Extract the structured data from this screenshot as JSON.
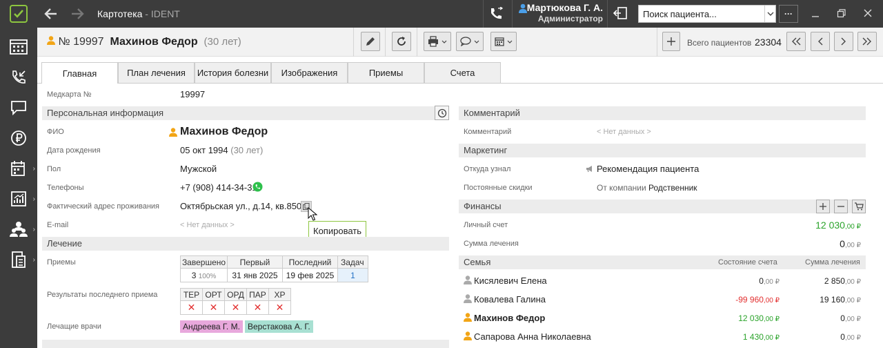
{
  "topbar": {
    "app_title": "Картотека",
    "app_suffix": " - IDENT",
    "user_name": "Мартюкова Г. А.",
    "user_role": "Администратор",
    "search_placeholder": "Поиск пациента...",
    "more_label": "···"
  },
  "header": {
    "card_number": "№ 19997",
    "patient_name": "Махинов Федор",
    "patient_age": "(30 лет)",
    "total_label": "Всего пациентов",
    "total_value": "23304"
  },
  "tabs": [
    "Главная",
    "План лечения",
    "История болезни",
    "Изображения",
    "Приемы",
    "Счета"
  ],
  "left": {
    "medcard_label": "Медкарта №",
    "medcard_value": "19997",
    "personal_section": "Персональная информация",
    "fio_label": "ФИО",
    "fio_value": "Махинов Федор",
    "dob_label": "Дата рождения",
    "dob_value": "05 окт 1994",
    "dob_age": "(30 лет)",
    "sex_label": "Пол",
    "sex_value": "Мужской",
    "phone_label": "Телефоны",
    "phone_value": "+7 (908) 414-34-31",
    "address_label": "Фактический адрес проживания",
    "address_value": "Октябрьская ул., д.14, кв.850",
    "copy_tooltip": "Копировать",
    "email_label": "E-mail",
    "email_value": "< Нет данных >",
    "treatment_section": "Лечение",
    "visits_label": "Приемы",
    "visits_headers": [
      "Завершено",
      "Первый",
      "Последний",
      "Задач"
    ],
    "visits_completed": "3",
    "visits_percent": "100%",
    "visits_first": "31 янв 2025",
    "visits_last": "19 фев 2025",
    "visits_tasks": "1",
    "results_label": "Результаты последнего приема",
    "results_headers": [
      "ТЕР",
      "ОРТ",
      "ОРД",
      "ПАР",
      "ХР"
    ],
    "results_mark": "✕",
    "doctors_label": "Лечащие врачи",
    "doctors": [
      "Андреева Г. М.",
      "Верстакова А. Г."
    ]
  },
  "right": {
    "comment_section": "Комментарий",
    "comment_label": "Комментарий",
    "comment_value": "< Нет данных >",
    "marketing_section": "Маркетинг",
    "source_label": "Откуда узнал",
    "source_value": "Рекомендация пациента",
    "discount_label": "Постоянные скидки",
    "discount_prefix": "От компании",
    "discount_value": "Родственник",
    "finance_section": "Финансы",
    "account_label": "Личный счет",
    "account_value": "12 030",
    "account_cents": ",00 ₽",
    "treatment_sum_label": "Сумма лечения",
    "treatment_sum_value": "0",
    "treatment_sum_cents": ",00 ₽",
    "family_section": "Семья",
    "family_col_account": "Состояние счета",
    "family_col_sum": "Сумма лечения",
    "family": [
      {
        "name": "Кисялевич Елена",
        "account": "0",
        "account_cents": ",00 ₽",
        "sum": "2 850",
        "sum_cents": ",00 ₽"
      },
      {
        "name": "Ковалева Галина",
        "account": "-99 960",
        "account_cents": ",00 ₽",
        "sum": "19 160",
        "sum_cents": ",00 ₽"
      },
      {
        "name": "Махинов Федор",
        "account": "12 030",
        "account_cents": ",00 ₽",
        "sum": "0",
        "sum_cents": ",00 ₽"
      },
      {
        "name": "Сапарова Анна Николаевна",
        "account": "1 430",
        "account_cents": ",00 ₽",
        "sum": "0",
        "sum_cents": ",00 ₽"
      }
    ]
  },
  "colors": {
    "accent_green": "#8dc63f",
    "dark_bg": "#3c3c3c",
    "user_orange": "#f2a516",
    "positive": "#2aa32a",
    "negative": "#e23030"
  }
}
